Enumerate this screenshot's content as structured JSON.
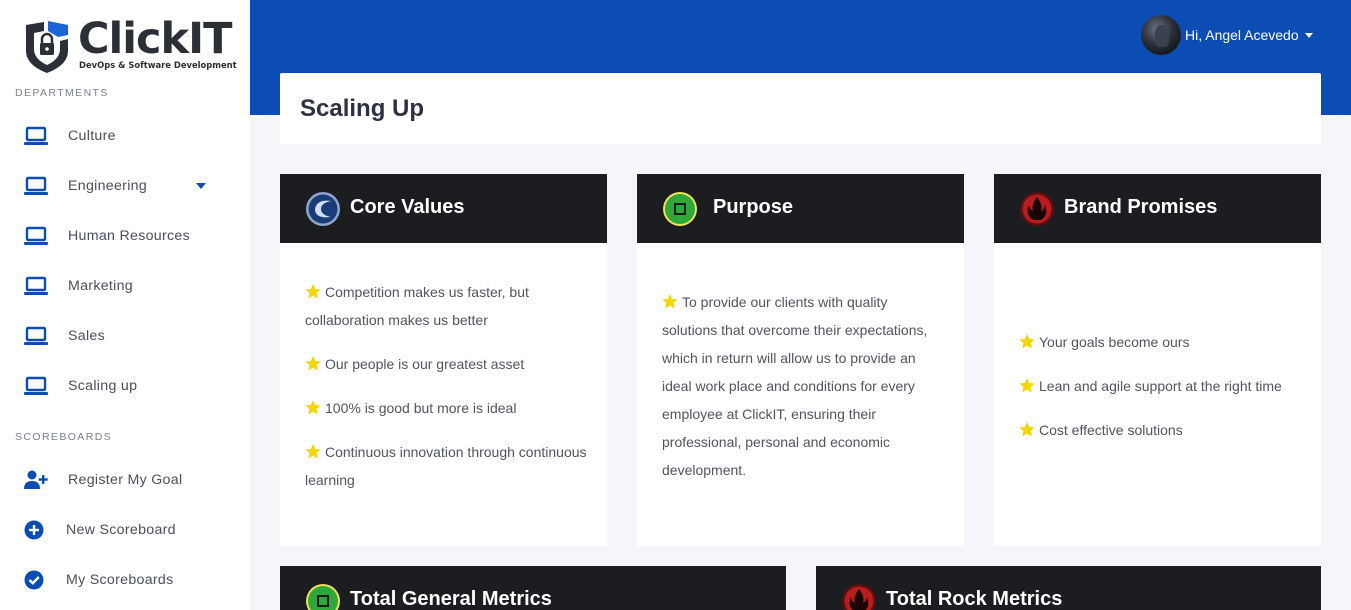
{
  "brand": {
    "name": "ClickIT",
    "tagline": "DevOps & Software Development"
  },
  "sidebar": {
    "departments_label": "DEPARTMENTS",
    "departments": [
      {
        "label": "Culture",
        "icon": "laptop-icon"
      },
      {
        "label": "Engineering",
        "icon": "laptop-icon",
        "has_dropdown": true
      },
      {
        "label": "Human Resources",
        "icon": "laptop-icon"
      },
      {
        "label": "Marketing",
        "icon": "laptop-icon"
      },
      {
        "label": "Sales",
        "icon": "laptop-icon"
      },
      {
        "label": "Scaling up",
        "icon": "laptop-icon"
      }
    ],
    "scoreboards_label": "SCOREBOARDS",
    "scoreboards": [
      {
        "label": "Register My Goal",
        "icon": "user-plus-icon"
      },
      {
        "label": "New Scoreboard",
        "icon": "plus-circle-icon"
      },
      {
        "label": "My Scoreboards",
        "icon": "check-circle-icon"
      }
    ]
  },
  "header": {
    "user_greeting": "Hi, Angel Acevedo"
  },
  "page": {
    "title": "Scaling Up"
  },
  "cards": {
    "core_values": {
      "title": "Core Values",
      "items": [
        "Competition makes us faster, but collaboration makes us better",
        "Our people is our greatest asset",
        "100% is good but more is ideal",
        "Continuous innovation through continuous learning"
      ]
    },
    "purpose": {
      "title": "Purpose",
      "text": "To provide our clients with quality solutions that overcome their expectations, which in return will allow us to provide an ideal work place and conditions for every employee at ClickIT, ensuring their professional, personal and economic development."
    },
    "brand_promises": {
      "title": "Brand Promises",
      "items": [
        "Your goals become ours",
        "Lean and agile support at the right time",
        "Cost effective solutions"
      ]
    },
    "total_general_metrics": {
      "title": "Total General Metrics"
    },
    "total_rock_metrics": {
      "title": "Total Rock Metrics"
    }
  },
  "colors": {
    "primary": "#0b4db3",
    "card_header": "#1b1d21",
    "star": "#f2d600",
    "background": "#f5f6fa"
  }
}
